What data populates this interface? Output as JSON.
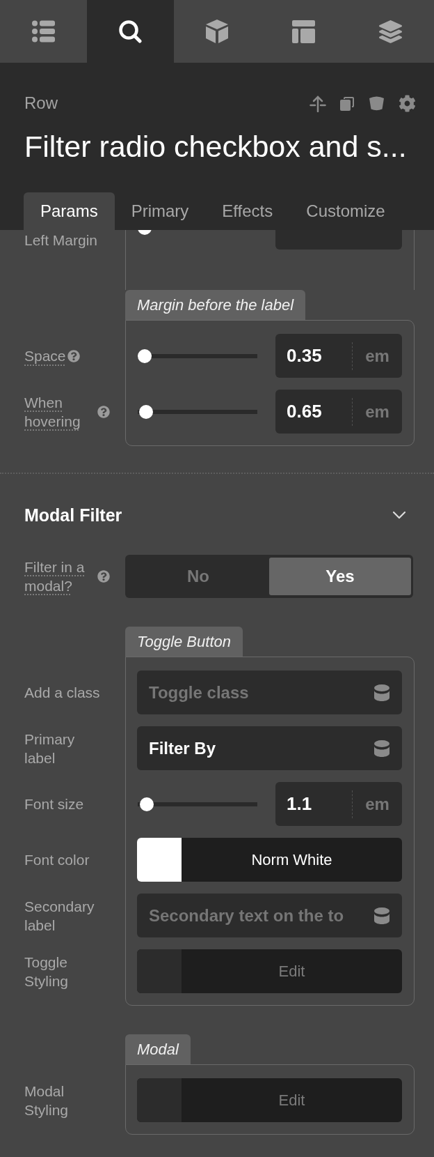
{
  "toolbar": [
    {
      "kind": "list",
      "selected": false
    },
    {
      "kind": "search",
      "selected": true
    },
    {
      "kind": "cube",
      "selected": false
    },
    {
      "kind": "layout",
      "selected": false
    },
    {
      "kind": "layers",
      "selected": false
    }
  ],
  "header": {
    "breadcrumb": "Row",
    "title": "Filter radio checkbox and s..."
  },
  "tabs": [
    {
      "label": "Params",
      "selected": true
    },
    {
      "label": "Primary",
      "selected": false
    },
    {
      "label": "Effects",
      "selected": false
    },
    {
      "label": "Customize",
      "selected": false
    }
  ],
  "groups": [
    {
      "rows": [
        {
          "kind": "slider",
          "label": "Left Margin",
          "help": false,
          "level": 0
        }
      ]
    },
    {
      "title": "Margin before the label",
      "rows": [
        {
          "kind": "slider",
          "label": "Space",
          "help": true,
          "level": 0,
          "value": "0.35",
          "unit": "em"
        },
        {
          "kind": "slider",
          "label": "When hovering",
          "help": true,
          "level": 0.01,
          "value": "0.65",
          "unit": "em"
        }
      ]
    }
  ],
  "section": {
    "title": "Modal Filter",
    "expanded": true,
    "rows": [
      {
        "kind": "segmented",
        "label": "Filter in a modal?",
        "help": true,
        "options": [
          {
            "label": "No",
            "selected": false
          },
          {
            "label": "Yes",
            "selected": true
          }
        ]
      }
    ],
    "groups": [
      {
        "title": "Toggle Button",
        "rows": [
          {
            "kind": "text",
            "label": "Add a class",
            "help": false,
            "placeholder": "Toggle class"
          },
          {
            "kind": "text",
            "label": "Primary label",
            "help": false,
            "value": "Filter By"
          },
          {
            "kind": "slider",
            "label": "Font size",
            "help": false,
            "level": 0.02,
            "value": "1.1",
            "unit": "em"
          },
          {
            "kind": "color",
            "label": "Font color",
            "help": false,
            "color": "#ffffff",
            "value": "Norm White"
          },
          {
            "kind": "text",
            "label": "Secondary label",
            "help": false,
            "placeholder": "Secondary text on the to"
          },
          {
            "kind": "edit",
            "label": "Toggle Styling",
            "help": false,
            "button": "Edit"
          }
        ]
      },
      {
        "title": "Modal",
        "rows": [
          {
            "kind": "edit",
            "label": "Modal Styling",
            "help": false,
            "button": "Edit"
          }
        ]
      }
    ]
  }
}
